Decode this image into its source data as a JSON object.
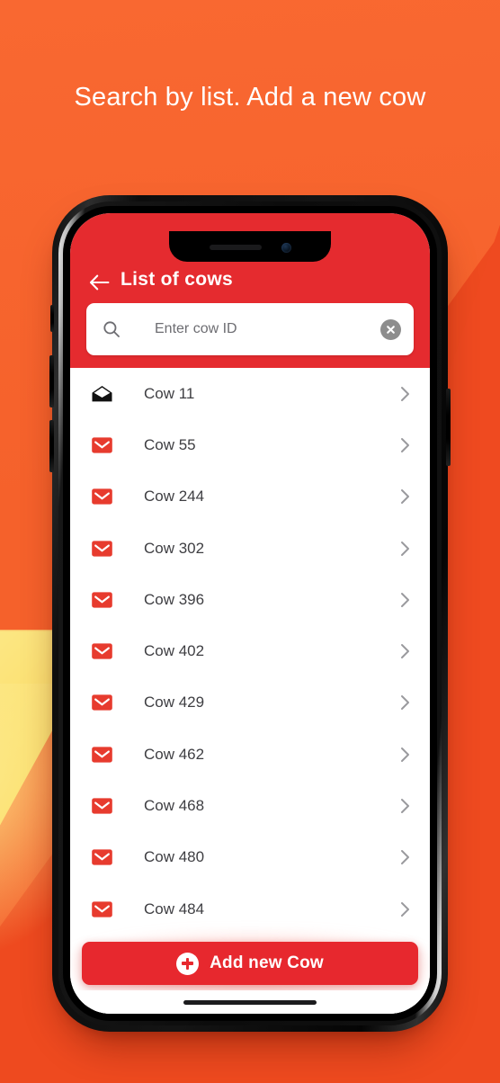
{
  "promo": {
    "headline": "Search by list. Add a new cow",
    "background_color": "#f5612b",
    "accent_yellow": "#fbdc63",
    "accent_deep_orange": "#ee4a1f"
  },
  "device": {
    "notch_speaker": "speaker-slot",
    "notch_camera": "front-camera",
    "home_indicator": "home-indicator",
    "buttons": [
      "mute-switch",
      "volume-up",
      "volume-down",
      "power"
    ]
  },
  "app": {
    "brand_red": "#e52b2f",
    "appbar": {
      "back_icon": "arrow-left-icon",
      "title": "List of cows"
    },
    "search": {
      "icon": "search-icon",
      "value": "",
      "placeholder": "Enter cow ID",
      "clear_icon": "close-circle-icon",
      "clear_color": "#8d8d8d"
    },
    "list": {
      "chevron_icon": "chevron-right-icon",
      "items": [
        {
          "label": "Cow 11",
          "icon": "mail-open-icon",
          "icon_color": "#111111",
          "read": true
        },
        {
          "label": "Cow 55",
          "icon": "mail-closed-icon",
          "icon_color": "#e73b2e",
          "read": false
        },
        {
          "label": "Cow 244",
          "icon": "mail-closed-icon",
          "icon_color": "#e73b2e",
          "read": false
        },
        {
          "label": "Cow 302",
          "icon": "mail-closed-icon",
          "icon_color": "#e73b2e",
          "read": false
        },
        {
          "label": "Cow 396",
          "icon": "mail-closed-icon",
          "icon_color": "#e73b2e",
          "read": false
        },
        {
          "label": "Cow 402",
          "icon": "mail-closed-icon",
          "icon_color": "#e73b2e",
          "read": false
        },
        {
          "label": "Cow 429",
          "icon": "mail-closed-icon",
          "icon_color": "#e73b2e",
          "read": false
        },
        {
          "label": "Cow 462",
          "icon": "mail-closed-icon",
          "icon_color": "#e73b2e",
          "read": false
        },
        {
          "label": "Cow 468",
          "icon": "mail-closed-icon",
          "icon_color": "#e73b2e",
          "read": false
        },
        {
          "label": "Cow 480",
          "icon": "mail-closed-icon",
          "icon_color": "#e73b2e",
          "read": false
        },
        {
          "label": "Cow 484",
          "icon": "mail-closed-icon",
          "icon_color": "#e73b2e",
          "read": false
        }
      ]
    },
    "cta": {
      "label": "Add new Cow",
      "icon": "plus-circle-icon",
      "color": "#e7282e"
    }
  }
}
